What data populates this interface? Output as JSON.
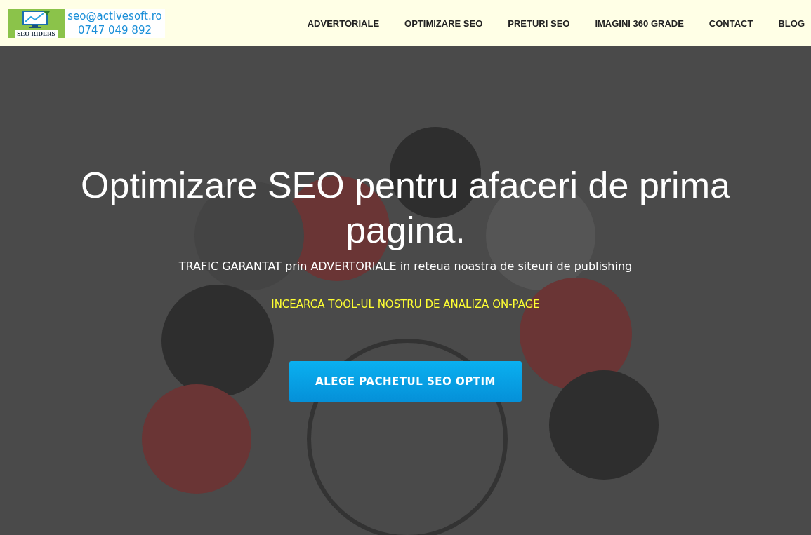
{
  "header": {
    "logo_text": "SEO RIDERS",
    "email": "seo@activesoft.ro",
    "phone": "0747 049 892",
    "nav": [
      {
        "label": "ADVERTORIALE"
      },
      {
        "label": "OPTIMIZARE SEO"
      },
      {
        "label": "PRETURI SEO"
      },
      {
        "label": "IMAGINI 360 GRADE"
      },
      {
        "label": "CONTACT"
      },
      {
        "label": "BLOG"
      }
    ]
  },
  "hero": {
    "title": "Optimizare SEO pentru afaceri de prima pagina.",
    "subtitle": "TRAFIC GARANTAT prin ADVERTORIALE in reteua noastra de siteuri de publishing",
    "link": "INCEARCA TOOL-UL NOSTRU DE ANALIZA ON-PAGE",
    "button": "ALEGE PACHETUL SEO OPTIM"
  }
}
